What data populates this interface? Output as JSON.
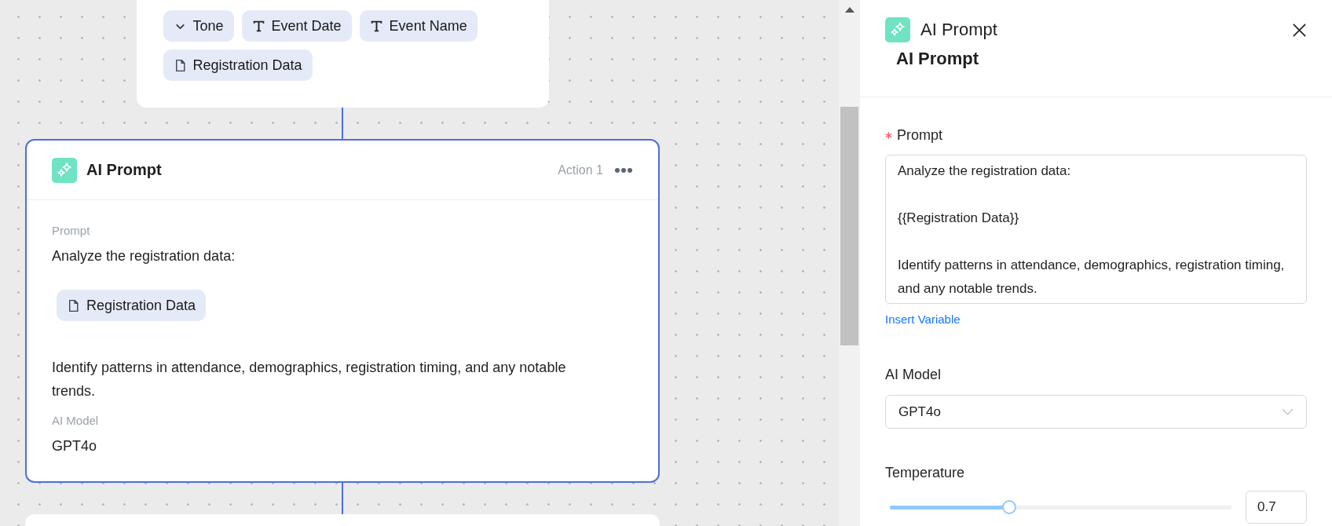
{
  "inputs_card": {
    "chips": [
      {
        "kind": "choice",
        "label": "Tone"
      },
      {
        "kind": "text",
        "label": "Event Date"
      },
      {
        "kind": "text",
        "label": "Event Name"
      },
      {
        "kind": "file",
        "label": "Registration Data"
      }
    ]
  },
  "action_card": {
    "title": "AI Prompt",
    "badge": "Action 1",
    "selected": true,
    "prompt_label": "Prompt",
    "prompt_intro": "Analyze the registration data:",
    "prompt_variable": "Registration Data",
    "prompt_outro": "Identify patterns in attendance, demographics, registration timing, and any notable trends.",
    "model_label": "AI Model",
    "model": "GPT4o"
  },
  "panel": {
    "type_label": "AI Prompt",
    "title": "AI Prompt",
    "prompt_label": "Prompt",
    "required": true,
    "prompt_value": "Analyze the registration data:\n\n{{Registration Data}}\n\nIdentify patterns in attendance, demographics, registration timing, and any notable trends.",
    "insert_link": "Insert Variable",
    "model_label": "AI Model",
    "model_value": "GPT4o",
    "temperature_label": "Temperature",
    "temperature": {
      "level": 0.35,
      "value": "0.7"
    }
  }
}
